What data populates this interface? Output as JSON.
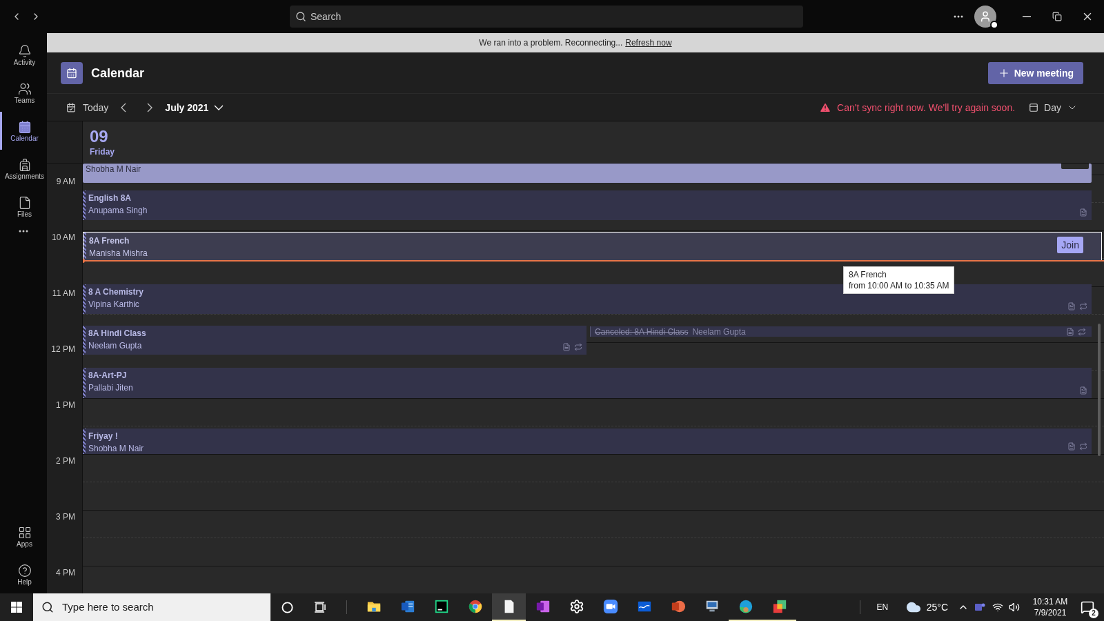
{
  "title_bar": {
    "search_placeholder": "Search"
  },
  "sidebar": {
    "items": [
      {
        "kind": "activity",
        "label": "Activity",
        "selected": false
      },
      {
        "kind": "teams",
        "label": "Teams",
        "selected": false
      },
      {
        "kind": "calendar",
        "label": "Calendar",
        "selected": true
      },
      {
        "kind": "assignments",
        "label": "Assignments",
        "selected": false
      },
      {
        "kind": "files",
        "label": "Files",
        "selected": false
      }
    ],
    "bottom_items": [
      {
        "kind": "apps",
        "label": "Apps"
      },
      {
        "kind": "help",
        "label": "Help"
      }
    ]
  },
  "banner": {
    "message": "We ran into a problem. Reconnecting...",
    "link": "Refresh now"
  },
  "header": {
    "title": "Calendar",
    "new_meeting": "New meeting"
  },
  "toolbar": {
    "today": "Today",
    "month": "July 2021",
    "sync_error": "Can't sync right now. We'll try again soon.",
    "view": "Day"
  },
  "day": {
    "date": "09",
    "weekday": "Friday"
  },
  "time_labels": [
    "9 AM",
    "10 AM",
    "11 AM",
    "12 PM",
    "1 PM",
    "2 PM",
    "3 PM",
    "4 PM"
  ],
  "events": [
    {
      "kind": "past",
      "organizer": "Shobha M Nair",
      "join_partial": true
    },
    {
      "kind": "event",
      "title": "English 8A",
      "organizer": "Anupama Singh",
      "notes": true,
      "recurring": false
    },
    {
      "kind": "current",
      "title": "8A French",
      "organizer": "Manisha Mishra",
      "join": "Join"
    },
    {
      "kind": "event",
      "title": "8 A Chemistry",
      "organizer": "Vipina Karthic",
      "notes": true,
      "recurring": true
    },
    {
      "kind": "event",
      "title": "8A Hindi Class",
      "organizer": "Neelam Gupta",
      "notes": true,
      "recurring": true
    },
    {
      "kind": "canceled",
      "title": "Canceled: 8A Hindi Class",
      "organizer": "Neelam Gupta",
      "notes": true,
      "recurring": true
    },
    {
      "kind": "event",
      "title": "8A-Art-PJ",
      "organizer": "Pallabi Jiten",
      "notes": true,
      "recurring": false
    },
    {
      "kind": "event",
      "title": "Friyay !",
      "organizer": "Shobha M Nair",
      "notes": true,
      "recurring": true
    }
  ],
  "tooltip": {
    "title": "8A French",
    "time": "from 10:00 AM to 10:35 AM"
  },
  "taskbar": {
    "search_placeholder": "Type here to search",
    "apps": [
      {
        "kind": "folder",
        "open": false,
        "selected": false
      },
      {
        "kind": "word",
        "open": false,
        "selected": false
      },
      {
        "kind": "ide",
        "open": false,
        "selected": false
      },
      {
        "kind": "chrome",
        "open": false,
        "selected": false
      },
      {
        "kind": "notepad",
        "open": true,
        "selected": true
      },
      {
        "kind": "onenote",
        "open": false,
        "selected": false
      },
      {
        "kind": "settings",
        "open": false,
        "selected": false
      },
      {
        "kind": "video",
        "open": false,
        "selected": false
      },
      {
        "kind": "whiteboard",
        "open": false,
        "selected": false
      },
      {
        "kind": "slides",
        "open": false,
        "selected": false
      },
      {
        "kind": "remote",
        "open": false,
        "selected": false
      },
      {
        "kind": "edge",
        "open": true,
        "selected": false
      },
      {
        "kind": "squares",
        "open": true,
        "selected": false
      }
    ],
    "language": "EN",
    "temperature": "25°C",
    "time": "10:31 AM",
    "date": "7/9/2021",
    "notifications": "2"
  }
}
